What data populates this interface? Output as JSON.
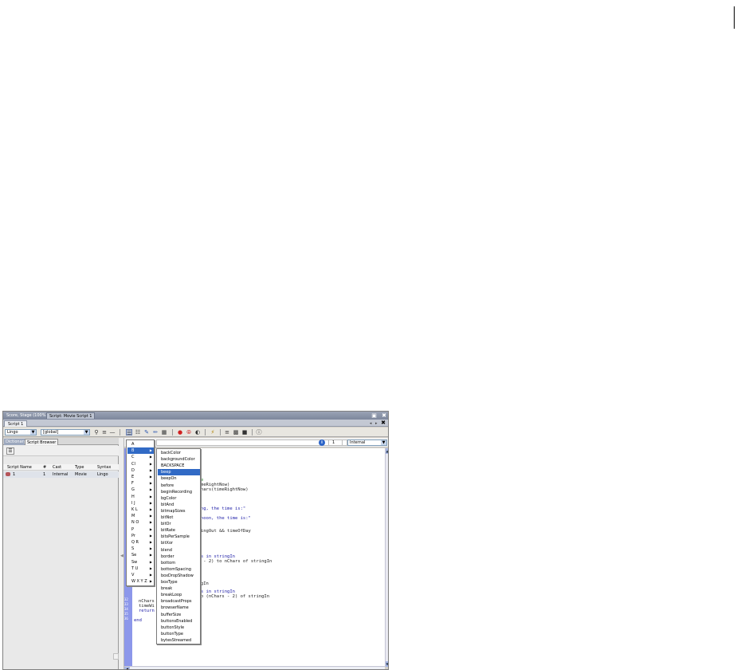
{
  "title_bar": {
    "tabs": [
      "Score, Stage (100%)",
      "Script: Movie Script 1"
    ],
    "buttons": [
      "▣",
      "✖"
    ]
  },
  "doc_tab": {
    "label": "Script 1",
    "controls": [
      "◂",
      "▸",
      "✖"
    ]
  },
  "toolbar": {
    "language": "Lingo",
    "scope": "[global]",
    "left_icons": [
      "find-icon",
      "compare-icon",
      "minus-icon"
    ],
    "right_icons": [
      "alphabetical-lingo-icon",
      "categorized-lingo-icon",
      "scripting-xtras-icon",
      "script-edit-icon",
      "debug-icon",
      "breakpoint-icon",
      "ignore-breakpoints-icon",
      "watch-icon",
      "recompile-icon",
      "comment-icon",
      "uncomment-icon",
      "cast-member-icon",
      "help-icon"
    ]
  },
  "left_panel": {
    "tabs": [
      "Dictionary",
      "Script Browser"
    ],
    "columns": [
      "Script Name",
      "#",
      "Cast",
      "Type",
      "Syntax"
    ],
    "rows": [
      {
        "name": "1",
        "num": "1",
        "cast": "Internal",
        "type": "Movie",
        "syntax": "Lingo"
      }
    ]
  },
  "editor_toolbar": {
    "small_field": "1",
    "cast_library": "Internal"
  },
  "code_lines": [
    {
      "text": "-- --",
      "color": "#1b7a1b"
    },
    {
      "text": "time",
      "color": "#1b7a1b"
    },
    {
      "text": "(timeRightNow)",
      "color": "#222222"
    },
    {
      "text": "zeChars(timeRightNow)",
      "color": "#222222"
    },
    {
      "text": "rning, the time is:\"",
      "color": "#1a1aa6"
    },
    {
      "text": "ternoon, the time is:\"",
      "color": "#1a1aa6"
    },
    {
      "text": "stringOut && timeOfDay",
      "color": "#222222"
    },
    {
      "text": "In",
      "color": "#222222"
    },
    {
      "text": "hars in stringIn",
      "color": "#1a1aa6"
    },
    {
      "text": "ars - 2) to nChars of stringIn",
      "color": "#222222"
    },
    {
      "text": "ringIn",
      "color": "#222222"
    },
    {
      "text": "hars in stringIn",
      "color": "#1a1aa6"
    },
    {
      "text": ") to (nChars - 2) of stringIn",
      "color": "#222222"
    },
    {
      "text": "nChars",
      "color": "#222222"
    },
    {
      "text": "timeWi",
      "color": "#222222"
    },
    {
      "text": "return",
      "color": "#1a1aa6"
    },
    {
      "text": "end",
      "color": "#1a1aa6"
    }
  ],
  "line_numbers": [
    "32",
    "33",
    "34",
    "35",
    "36"
  ],
  "menu_letters": [
    {
      "label": "A",
      "submenu": false
    },
    {
      "label": "B",
      "submenu": true
    },
    {
      "label": "C",
      "submenu": true
    },
    {
      "label": "Cl",
      "submenu": true
    },
    {
      "label": "D",
      "submenu": true
    },
    {
      "label": "E",
      "submenu": true
    },
    {
      "label": "F",
      "submenu": true
    },
    {
      "label": "G",
      "submenu": true
    },
    {
      "label": "H",
      "submenu": true
    },
    {
      "label": "I J",
      "submenu": true
    },
    {
      "label": "K L",
      "submenu": true
    },
    {
      "label": "M",
      "submenu": true
    },
    {
      "label": "N O",
      "submenu": true
    },
    {
      "label": "P",
      "submenu": true
    },
    {
      "label": "Pr",
      "submenu": true
    },
    {
      "label": "Q R",
      "submenu": true
    },
    {
      "label": "S",
      "submenu": true
    },
    {
      "label": "Se",
      "submenu": true
    },
    {
      "label": "Sw",
      "submenu": true
    },
    {
      "label": "T U",
      "submenu": true
    },
    {
      "label": "V",
      "submenu": true
    },
    {
      "label": "W X Y Z",
      "submenu": true
    }
  ],
  "menu_highlight_index": 1,
  "menu_b_items": [
    "backColor",
    "backgroundColor",
    "BACKSPACE",
    "beep",
    "beepOn",
    "before",
    "beginRecording",
    "bgColor",
    "bitAnd",
    "bitmapSizes",
    "bitNot",
    "bitOr",
    "bitRate",
    "bitsPerSample",
    "bitXor",
    "blend",
    "border",
    "bottom",
    "bottomSpacing",
    "boxDropShadow",
    "boxType",
    "break",
    "breakLoop",
    "broadcastProps",
    "browserName",
    "bufferSize",
    "buttonsEnabled",
    "buttonStyle",
    "buttonType",
    "bytesStreamed"
  ],
  "menu_b_highlight_index": 3,
  "colors": {
    "highlight": "#316ac5",
    "gutter": "#8c97ea",
    "titlebar": "#7d879c"
  }
}
